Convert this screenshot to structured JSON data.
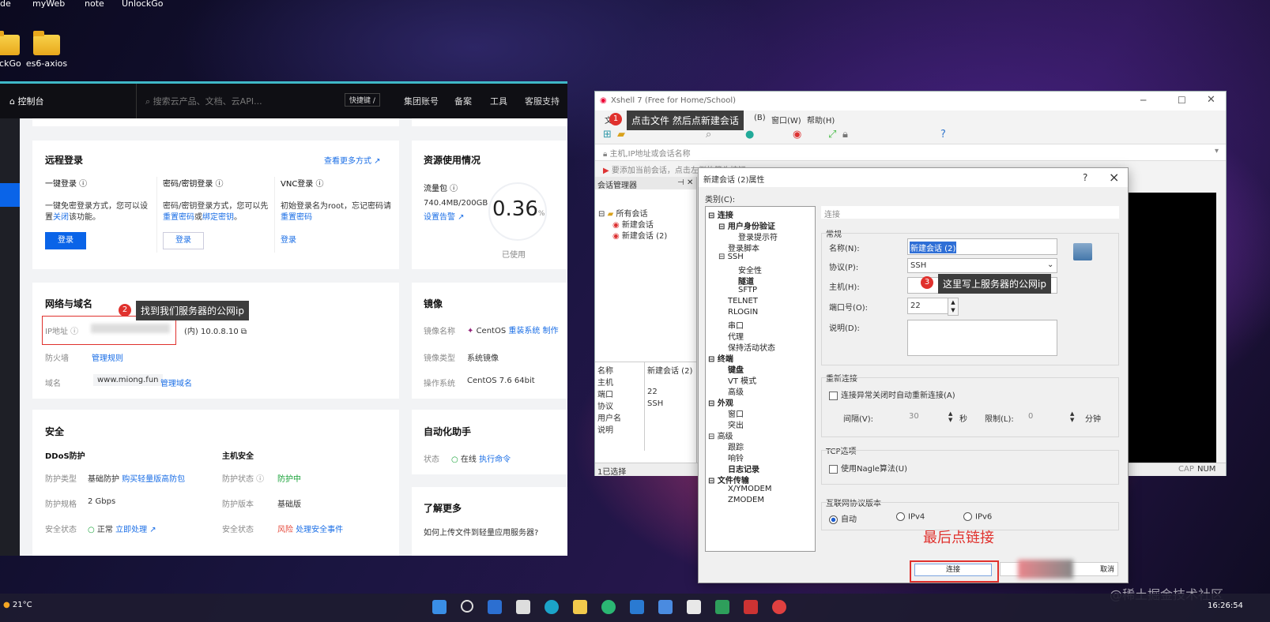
{
  "desktop": {
    "top_labels": [
      "de",
      "myWeb",
      "note",
      "UnlockGo"
    ],
    "icons": [
      {
        "label": "lockGo"
      },
      {
        "label": "es6-axios"
      }
    ]
  },
  "console": {
    "nav": {
      "home": "控制台",
      "search_placeholder": "搜索云产品、文档、云API...",
      "shortcut": "快捷键 /",
      "links": [
        "集团账号",
        "备案",
        "工具",
        "客服支持"
      ]
    },
    "remote": {
      "title": "远程登录",
      "more": "查看更多方式",
      "col1": {
        "title": "一键登录",
        "desc": "一键免密登录方式，您可以设",
        "desc2a": "置",
        "desc2b": "关闭",
        "desc2c": "该功能。",
        "btn": "登录"
      },
      "col2": {
        "title": "密码/密钥登录",
        "desc": "密码/密钥登录方式，您可以先",
        "desc2a": "重置密码",
        "desc2b": "或",
        "desc2c": "绑定密钥",
        "desc2d": "。",
        "btn": "登录"
      },
      "col3": {
        "title": "VNC登录",
        "desc": "初始登录名为root，忘记密码请",
        "desc2": "重置密码",
        "btn": "登录"
      }
    },
    "resource": {
      "title": "资源使用情况",
      "traffic_label": "流量包",
      "traffic_value": "740.4MB/200GB",
      "alert": "设置告警",
      "gauge_value": "0.36",
      "gauge_unit": "%",
      "gauge_label": "已使用"
    },
    "network": {
      "title": "网络与域名",
      "ip_label": "IP地址",
      "ip_inner": "(内) 10.0.8.10",
      "firewall_label": "防火墙",
      "firewall_link": "管理规则",
      "domain_label": "域名",
      "domain_value": "www.miong.fun",
      "domain_link": "管理域名"
    },
    "image": {
      "title": "镜像",
      "name_label": "镜像名称",
      "name_value": "CentOS",
      "name_link": "重装系统",
      "name_link2": "制作",
      "type_label": "镜像类型",
      "type_value": "系统镜像",
      "os_label": "操作系统",
      "os_value": "CentOS 7.6 64bit"
    },
    "security": {
      "title": "安全",
      "ddos": "DDoS防护",
      "host": "主机安全",
      "rows": [
        {
          "l1": "防护类型",
          "v1": "基础防护",
          "v1b": "购买轻量版高防包",
          "l2": "防护状态",
          "v2": "防护中"
        },
        {
          "l1": "防护规格",
          "v1": "2 Gbps",
          "v1b": "",
          "l2": "防护版本",
          "v2": "基础版"
        },
        {
          "l1": "安全状态",
          "v1": "正常",
          "v1b": "立即处理",
          "l2": "安全状态",
          "v2": "风险",
          "v2b": "处理安全事件"
        }
      ]
    },
    "automation": {
      "title": "自动化助手",
      "status_label": "状态",
      "status_value": "在线",
      "link": "执行命令"
    },
    "learn": {
      "title": "了解更多",
      "item": "如何上传文件到轻量应用服务器?"
    }
  },
  "annotations": {
    "a1": {
      "num": "1",
      "text": "点击文件 然后点新建会话"
    },
    "a2": {
      "num": "2",
      "text": "找到我们服务器的公网ip"
    },
    "a3": {
      "num": "3",
      "text": "这里写上服务器的公网ip"
    },
    "final": "最后点链接"
  },
  "xshell": {
    "title": "Xshell 7 (Free for Home/School)",
    "menu": [
      "文件",
      "(B)",
      "窗口(W)",
      "帮助(H)"
    ],
    "address_placeholder": "主机,IP地址或会话名称",
    "hint": "要添加当前会话，点击左侧的箭头按钮。",
    "session_manager": "会话管理器",
    "tree": {
      "root": "所有会话",
      "items": [
        "新建会话",
        "新建会话 (2)"
      ]
    },
    "props": [
      [
        "名称",
        "新建会话 (2)"
      ],
      [
        "主机",
        ""
      ],
      [
        "端口",
        "22"
      ],
      [
        "协议",
        "SSH"
      ],
      [
        "用户名",
        ""
      ],
      [
        "说明",
        ""
      ]
    ],
    "status_left": "1已选择",
    "status_right": [
      "CAP",
      "NUM"
    ]
  },
  "dialog": {
    "title": "新建会话 (2)属性",
    "category_label": "类别(C):",
    "tree": [
      "连接",
      "用户身份验证",
      "登录提示符",
      "登录脚本",
      "SSH",
      "安全性",
      "隧道",
      "SFTP",
      "TELNET",
      "RLOGIN",
      "串口",
      "代理",
      "保持活动状态",
      "终端",
      "键盘",
      "VT 模式",
      "高级",
      "外观",
      "窗口",
      "突出",
      "高级",
      "跟踪",
      "响铃",
      "日志记录",
      "文件传输",
      "X/YMODEM",
      "ZMODEM"
    ],
    "section": "连接",
    "general": "常规",
    "name_label": "名称(N):",
    "name_value": "新建会话 (2)",
    "protocol_label": "协议(P):",
    "protocol_value": "SSH",
    "host_label": "主机(H):",
    "port_label": "端口号(O):",
    "port_value": "22",
    "desc_label": "说明(D):",
    "reconnect": "重新连接",
    "reconnect_chk": "连接异常关闭时自动重新连接(A)",
    "interval_label": "间隔(V):",
    "interval_value": "30",
    "sec": "秒",
    "limit_label": "限制(L):",
    "limit_value": "0",
    "min": "分钟",
    "tcp": "TCP选项",
    "nagle": "使用Nagle算法(U)",
    "ipver": "互联网协议版本",
    "auto": "自动",
    "ipv4": "IPv4",
    "ipv6": "IPv6",
    "connect_btn": "连接",
    "cancel_btn": "取消",
    "help": "?",
    "close": "×"
  },
  "taskbar": {
    "weather": "21°C",
    "time": "16:26:54"
  },
  "watermark": "@稀土掘金技术社区",
  "colors": {
    "accent": "#0a64e8",
    "annotation_red": "#e0312d",
    "teal": "#3fb8c7"
  }
}
